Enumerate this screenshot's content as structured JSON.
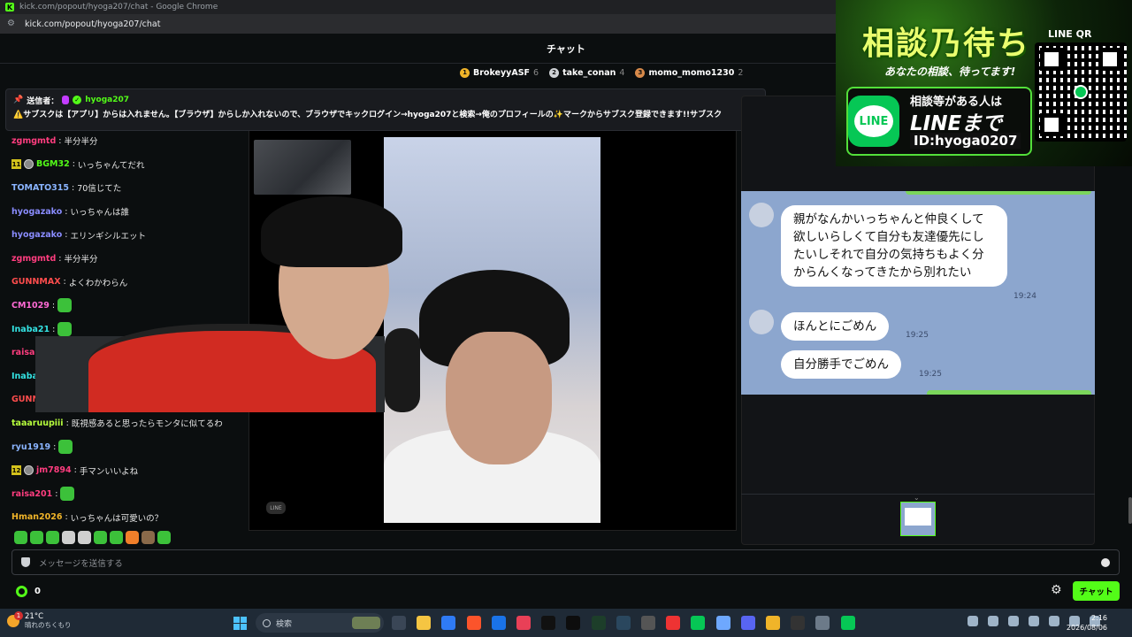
{
  "browser": {
    "title": "kick.com/popout/hyoga207/chat - Google Chrome",
    "url": "kick.com/popout/hyoga207/chat",
    "favicon_letter": "K"
  },
  "chat": {
    "header_title": "チャット",
    "leaderboard": [
      {
        "rank": "1",
        "name": "BrokeyyASF",
        "count": "6",
        "color": "#f0b429"
      },
      {
        "rank": "2",
        "name": "take_conan",
        "count": "4",
        "color": "#cfd2d6"
      },
      {
        "rank": "3",
        "name": "momo_momo1230",
        "count": "2",
        "color": "#d88a4a"
      }
    ],
    "pinned": {
      "sender_label": "送信者：",
      "sender_name": "hyoga207",
      "message": "⚠️サブスクは【アプリ】からは入れません。【ブラウザ】からしか入れないので、ブラウザでキックログイン→hyoga207と検索→俺のプロフィールの✨マークからサブスク登録できます!!サブスク"
    },
    "messages": [
      {
        "badge": "",
        "user": "zgmgmtd",
        "color": "#ff3d7f",
        "text": "半分半分"
      },
      {
        "badge": "11",
        "user": "BGM32",
        "color": "#53fc18",
        "text": "いっちゃんてだれ"
      },
      {
        "badge": "",
        "user": "TOMATO315",
        "color": "#8ab4ff",
        "text": "70信じてた"
      },
      {
        "badge": "",
        "user": "hyogazako",
        "color": "#8a8cff",
        "text": "いっちゃんは誰"
      },
      {
        "badge": "",
        "user": "hyogazako",
        "color": "#8a8cff",
        "text": "エリンギシルエット"
      },
      {
        "badge": "",
        "user": "zgmgmtd",
        "color": "#ff3d7f",
        "text": "半分半分"
      },
      {
        "badge": "",
        "user": "GUNNMAX",
        "color": "#ff4d4d",
        "text": "よくわかわらん"
      },
      {
        "badge": "",
        "user": "CM1029",
        "color": "#ff6ad5",
        "text": ""
      },
      {
        "badge": "",
        "user": "Inaba21",
        "color": "#34e3e3",
        "text": ""
      },
      {
        "badge": "",
        "user": "raisa201",
        "color": "#ff3d7f",
        "text": ""
      },
      {
        "badge": "",
        "user": "Inaba21",
        "color": "#34e3e3",
        "text": ""
      },
      {
        "badge": "",
        "user": "GUNNMAX",
        "color": "#ff4d4d",
        "text": ""
      },
      {
        "badge": "",
        "user": "taaaruupiii",
        "color": "#b7ff3d",
        "text": "既視感あると思ったらモンタに似てるわ"
      },
      {
        "badge": "",
        "user": "ryu1919",
        "color": "#8ab4ff",
        "text": ""
      },
      {
        "badge": "12",
        "user": "jm7894",
        "color": "#ff3d7f",
        "text": "手マンいいよね"
      },
      {
        "badge": "",
        "user": "raisa201",
        "color": "#ff3d7f",
        "text": ""
      },
      {
        "badge": "",
        "user": "Hman2026",
        "color": "#f0b429",
        "text": "いっちゃんは可愛いの？"
      }
    ],
    "input_placeholder": "メッセージを送信する",
    "points": "0",
    "chat_button": "チャット"
  },
  "line_chat": {
    "bubbles": [
      {
        "text": "親がなんかいっちゃんと仲良くして欲しいらしくて自分も友達優先にしたいしそれで自分の気持ちもよく分からんくなってきたから別れたい",
        "time": "19:24"
      },
      {
        "text": "ほんとにごめん",
        "time": "19:25"
      },
      {
        "text": "自分勝手でごめん",
        "time": "19:25"
      }
    ],
    "watermark": "LINE"
  },
  "promo": {
    "headline": "相談乃待ち",
    "sub": "あなたの相談、待ってます!",
    "cta_line1": "相談等がある人は",
    "cta_line2": "LINEまで",
    "line_id": "ID:hyoga0207",
    "qr_title": "LINE QR",
    "logo_text": "LINE"
  },
  "taskbar": {
    "temperature": "21°C",
    "condition": "晴れのちくもり",
    "weather_alert": "1",
    "search_placeholder": "検索",
    "time": "2:16",
    "date": "2026/08/06"
  }
}
